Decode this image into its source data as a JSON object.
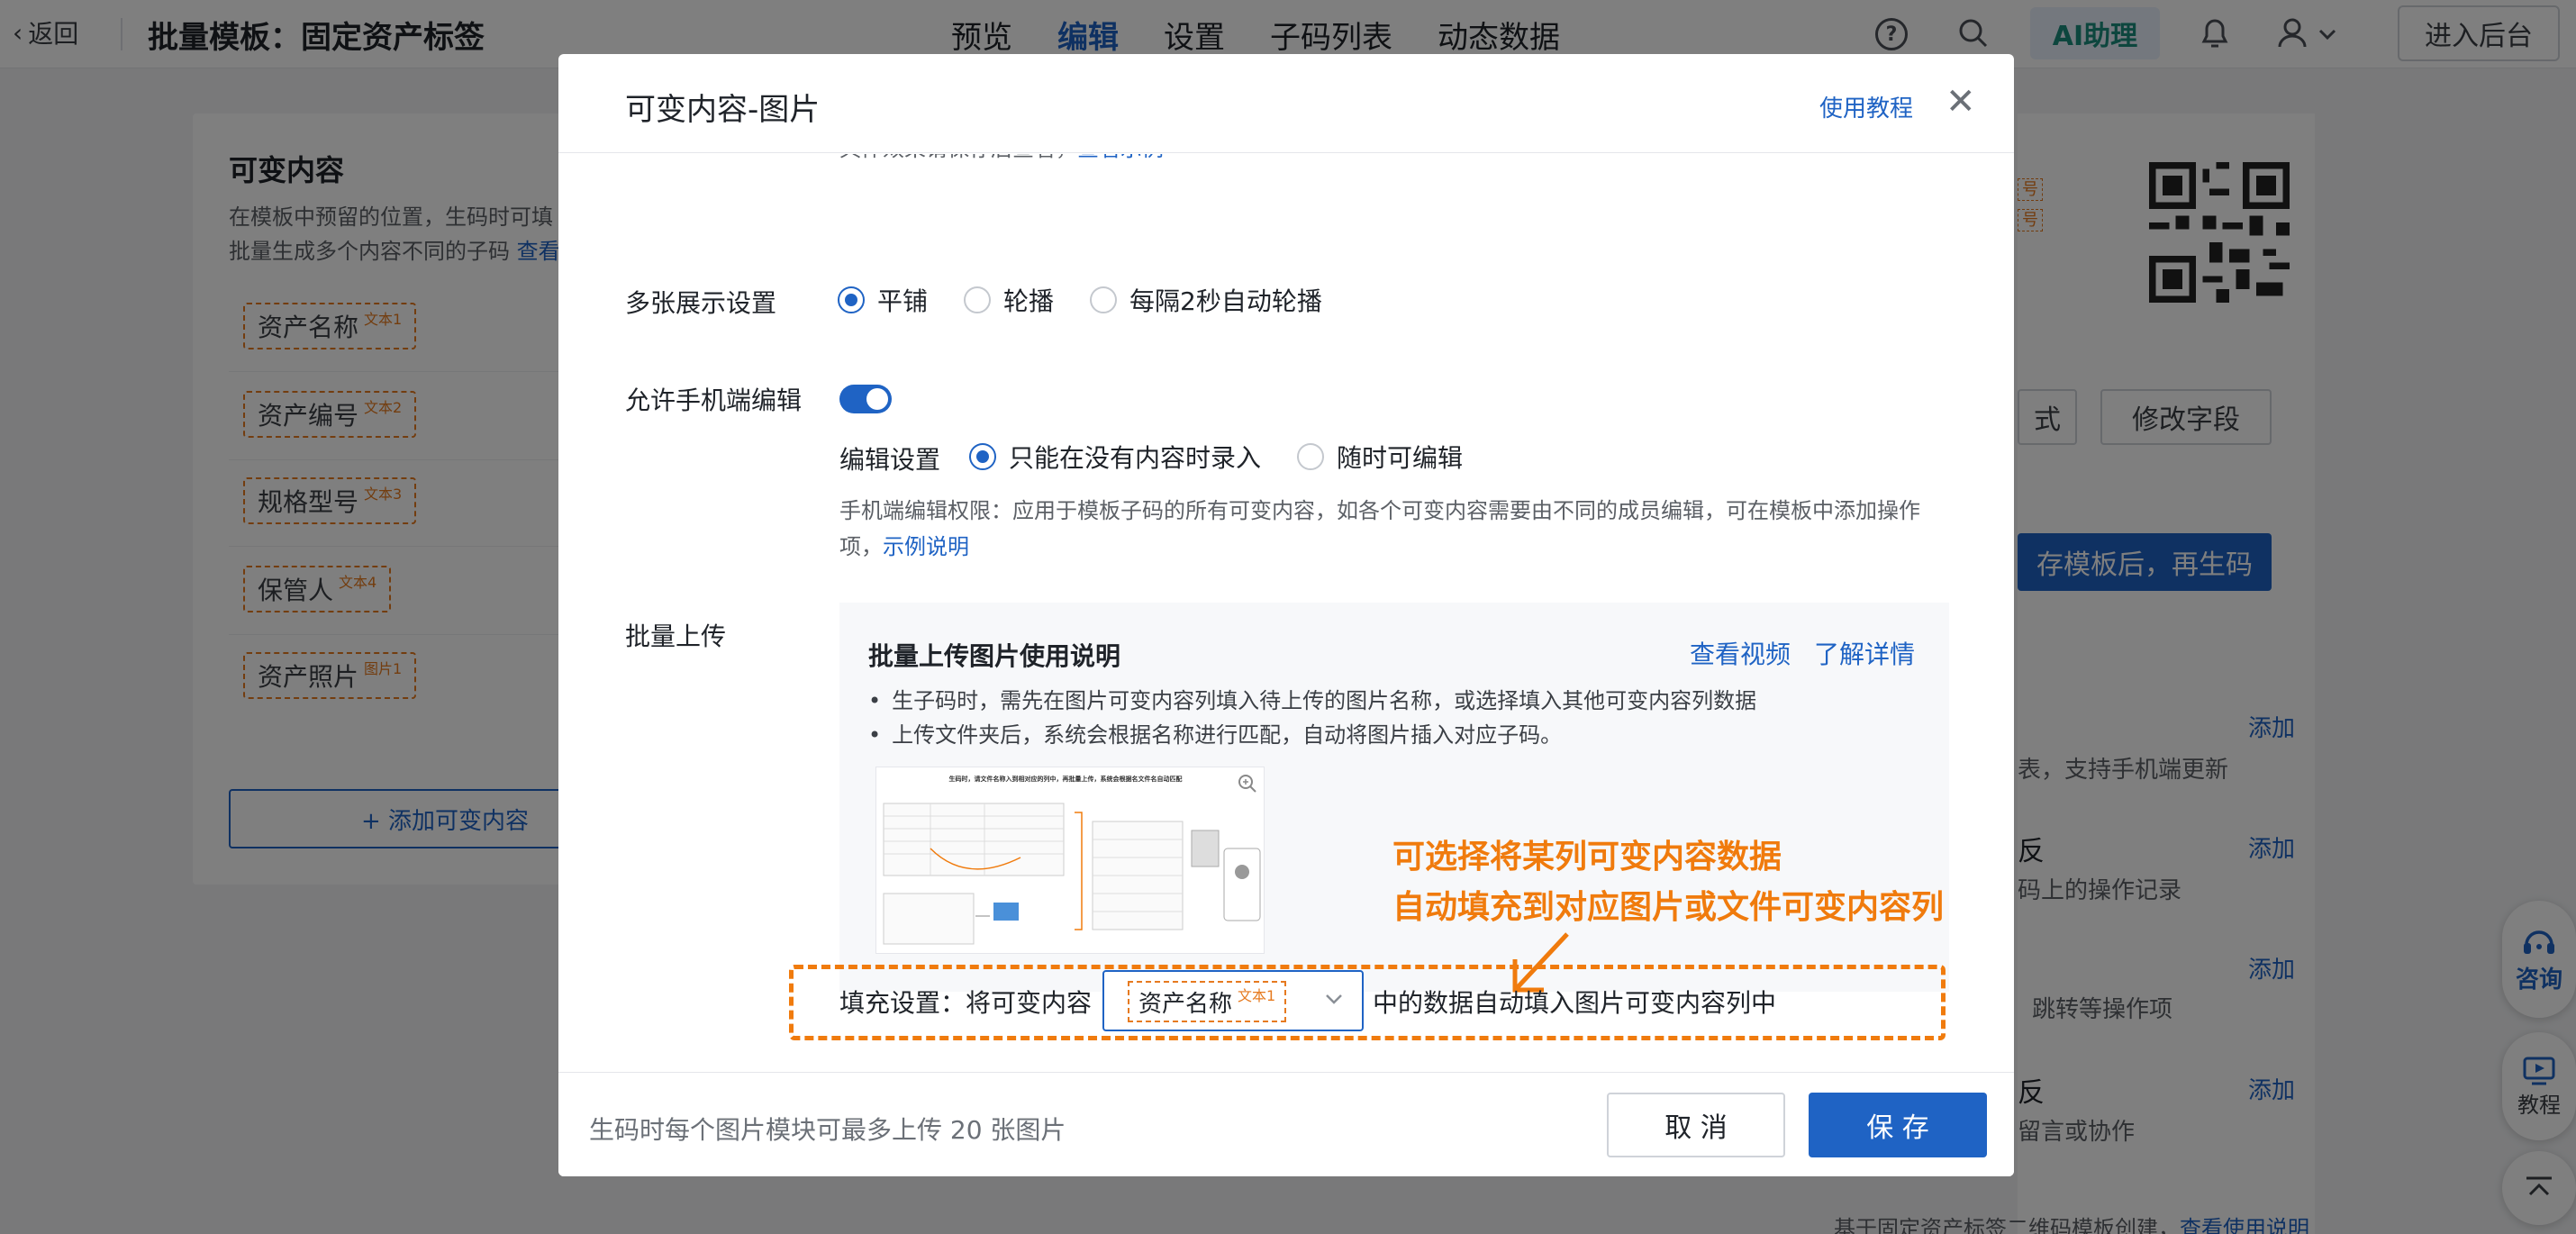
{
  "topbar": {
    "back_label": "返回",
    "page_title": "批量模板：固定资产标签",
    "nav": [
      "预览",
      "编辑",
      "设置",
      "子码列表",
      "动态数据"
    ],
    "active_nav": "编辑",
    "ai_label": "AI助理",
    "backend_label": "进入后台"
  },
  "left_panel": {
    "title": "可变内容",
    "desc_line1": "在模板中预留的位置，生码时可填",
    "desc_line2": "批量生成多个内容不同的子码",
    "desc_link": "查看",
    "fields": [
      {
        "label": "资产名称",
        "tag": "文本1"
      },
      {
        "label": "资产编号",
        "tag": "文本2"
      },
      {
        "label": "规格型号",
        "tag": "文本3"
      },
      {
        "label": "保管人",
        "tag": "文本4"
      },
      {
        "label": "资产照片",
        "tag": "图片1"
      }
    ],
    "add_label": "+ 添加可变内容"
  },
  "right_panel": {
    "badge1": "号",
    "badge2": "号",
    "btn_style": "式",
    "btn_edit_fields": "修改字段",
    "blue_btn": "存模板后，再生码",
    "add_label": "添加",
    "row1_text": "表，支持手机端更新",
    "row2_title": "反",
    "row2_text": "码上的操作记录",
    "row3_text": "跳转等操作项",
    "row4_title": "反",
    "row4_text": "留言或协作",
    "bottom_text": "基于固定资产标签二维码模板创建，",
    "bottom_link": "查看使用说明"
  },
  "float": {
    "consult": "咨询",
    "tutorial": "教程"
  },
  "modal": {
    "title": "可变内容-图片",
    "tutorial_link": "使用教程",
    "top_hint": "具体效果请保存后查看，",
    "top_hint_link": "查看示例",
    "multi_display": {
      "label": "多张展示设置",
      "options": [
        "平铺",
        "轮播",
        "每隔2秒自动轮播"
      ],
      "selected": "平铺"
    },
    "mobile_edit": {
      "label": "允许手机端编辑",
      "enabled": true,
      "setting_label": "编辑设置",
      "options": [
        "只能在没有内容时录入",
        "随时可编辑"
      ],
      "selected": "只能在没有内容时录入",
      "hint_line1": "手机端编辑权限：应用于模板子码的所有可变内容，如各个可变内容需要由不同的成员编辑，可在模板中添加操作",
      "hint_line2": "项，",
      "hint_link": "示例说明"
    },
    "batch_upload": {
      "label": "批量上传",
      "box_title": "批量上传图片使用说明",
      "link_video": "查看视频",
      "link_detail": "了解详情",
      "bullets": [
        "生子码时，需先在图片可变内容列填入待上传的图片名称，或选择填入其他可变内容列数据",
        "上传文件夹后，系统会根据名称进行匹配，自动将图片插入对应子码。"
      ],
      "thumb_caption": "生码时，请文件名称入到相对应的列中，再批量上传，系统会根据名文件名自动匹配"
    },
    "annotation_line1": "可选择将某列可变内容数据",
    "annotation_line2": "自动填充到对应图片或文件可变内容列",
    "fill": {
      "prefix": "填充设置：将可变内容",
      "selected_value": "资产名称",
      "selected_tag": "文本1",
      "suffix": "中的数据自动填入图片可变内容列中"
    },
    "footer_text": "生码时每个图片模块可最多上传 20 张图片",
    "cancel_label": "取 消",
    "save_label": "保 存"
  },
  "colors": {
    "primary": "#1f63c4",
    "annotation": "#f07b0d",
    "tag_border": "#e67a1f"
  }
}
